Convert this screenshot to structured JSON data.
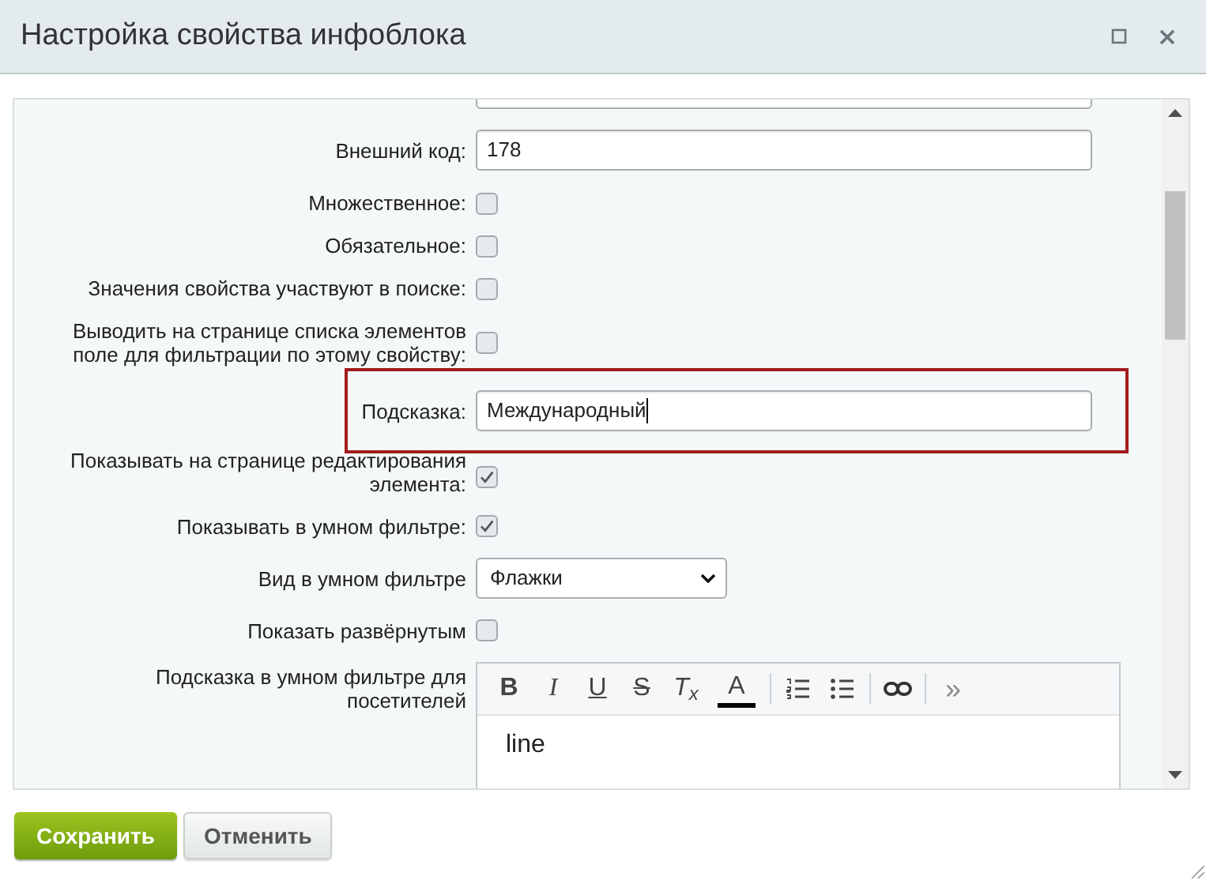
{
  "window": {
    "title": "Настройка свойства инфоблока"
  },
  "rows": [
    {
      "kind": "text"
    },
    {
      "kind": "text",
      "label": "Внешний код:",
      "value": "178"
    },
    {
      "kind": "checkbox",
      "label": "Множественное:",
      "checked": false
    },
    {
      "kind": "checkbox",
      "label": "Обязательное:",
      "checked": false
    },
    {
      "kind": "checkbox",
      "label": "Значения свойства участвуют в поиске:",
      "checked": false
    },
    {
      "kind": "checkbox",
      "label": "Выводить на странице списка элементов поле для фильтрации по этому свойству:",
      "checked": false
    },
    {
      "kind": "text",
      "label": "Подсказка:",
      "value": "Международный",
      "highlighted": true,
      "focused": true
    },
    {
      "kind": "checkbox",
      "label": "Показывать на странице редактирования элемента:",
      "checked": true
    },
    {
      "kind": "checkbox",
      "label": "Показывать в умном фильтре:",
      "checked": true
    },
    {
      "kind": "select",
      "label": "Вид в умном фильтре",
      "value": "Флажки"
    },
    {
      "kind": "checkbox",
      "label": "Показать развёрнутым",
      "checked": false
    },
    {
      "kind": "editor",
      "label": "Подсказка в умном фильтре для посетителей",
      "content": "line"
    }
  ],
  "toolbar": [
    {
      "kind": "bold",
      "label": "B"
    },
    {
      "kind": "italic",
      "label": "I"
    },
    {
      "kind": "underline",
      "label": "U"
    },
    {
      "kind": "strike",
      "label": "S"
    },
    {
      "kind": "clear",
      "label": "T",
      "sub": "x"
    },
    {
      "kind": "color",
      "label": "A"
    },
    {
      "kind": "separator"
    },
    {
      "kind": "ordered-list"
    },
    {
      "kind": "bullet-list"
    },
    {
      "kind": "separator"
    },
    {
      "kind": "link"
    },
    {
      "kind": "separator"
    },
    {
      "kind": "more",
      "label": "»"
    }
  ],
  "buttons": [
    {
      "label": "Сохранить",
      "primary": true
    },
    {
      "label": "Отменить",
      "primary": false
    }
  ]
}
